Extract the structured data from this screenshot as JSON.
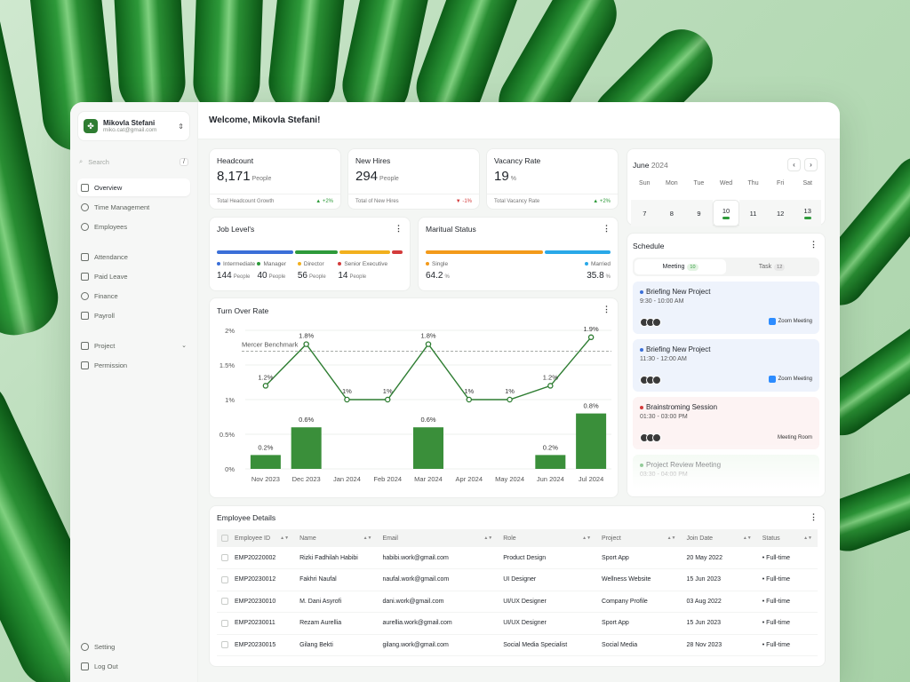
{
  "user": {
    "name": "Mikovla Stefani",
    "email": "miko.cat@gmail.com"
  },
  "search": {
    "placeholder": "Search",
    "shortcut": "/"
  },
  "nav": {
    "primary": [
      "Overview",
      "Time Management",
      "Employees"
    ],
    "secondary": [
      "Attendance",
      "Paid Leave",
      "Finance",
      "Payroll"
    ],
    "tertiary": [
      "Project",
      "Permission"
    ],
    "bottom": [
      "Setting",
      "Log Out"
    ]
  },
  "welcome": "Welcome, Mikovla Stefani!",
  "stats": [
    {
      "label": "Headcount",
      "value": "8,171",
      "unit": "People",
      "foot": "Total Headcount Growth",
      "change": "+2%",
      "dir": "up",
      "arrow": "▲"
    },
    {
      "label": "New Hires",
      "value": "294",
      "unit": "People",
      "foot": "Total of New Hires",
      "change": "-1%",
      "dir": "down",
      "arrow": "▼"
    },
    {
      "label": "Vacancy Rate",
      "value": "19",
      "unit": "%",
      "foot": "Total Vacancy Rate",
      "change": "+2%",
      "dir": "up",
      "arrow": "▲"
    }
  ],
  "job_levels": {
    "title": "Job Level's",
    "items": [
      {
        "label": "Intermediate",
        "value": "144",
        "unit": "People",
        "color": "#3b6fd8",
        "weight": 144
      },
      {
        "label": "Manager",
        "value": "40",
        "unit": "People",
        "color": "#2e9a3a",
        "weight": 80
      },
      {
        "label": "Director",
        "value": "56",
        "unit": "People",
        "color": "#f2b01e",
        "weight": 95
      },
      {
        "label": "Senior Executive",
        "value": "14",
        "unit": "People",
        "color": "#d33b3b",
        "weight": 20
      }
    ]
  },
  "marital": {
    "title": "Maritual Status",
    "items": [
      {
        "label": "Single",
        "value": "64.2",
        "unit": "%",
        "color": "#f39a1a"
      },
      {
        "label": "Married",
        "value": "35.8",
        "unit": "%",
        "color": "#29a8e8"
      }
    ]
  },
  "chart_data": {
    "type": "bar",
    "title": "Turn Over Rate",
    "categories": [
      "Nov 2023",
      "Dec 2023",
      "Jan 2024",
      "Feb 2024",
      "Mar 2024",
      "Apr 2024",
      "May 2024",
      "Jun 2024",
      "Jul 2024"
    ],
    "y_ticks": [
      "0%",
      "0.5%",
      "1%",
      "1.5%",
      "2%"
    ],
    "ylim": [
      0,
      2
    ],
    "benchmark": {
      "label": "Mercer Benchmark",
      "value": 1.7
    },
    "series": [
      {
        "type": "bar",
        "values": [
          0.2,
          0.6,
          0,
          0,
          0.6,
          0,
          0,
          0.2,
          0.8
        ],
        "labels": [
          "0.2%",
          "0.6%",
          "",
          "",
          "0.6%",
          "",
          "",
          "0.2%",
          "0.8%"
        ],
        "color": "#3a8f3a"
      },
      {
        "type": "line",
        "values": [
          1.2,
          1.8,
          1,
          1,
          1.8,
          1,
          1,
          1.2,
          1.9
        ],
        "labels": [
          "1.2%",
          "1.8%",
          "1%",
          "1%",
          "1.8%",
          "1%",
          "1%",
          "1.2%",
          "1.9%"
        ],
        "color": "#2e7d32"
      }
    ],
    "grid": true
  },
  "calendar": {
    "month": "June",
    "year": "2024",
    "days": [
      "Sun",
      "Mon",
      "Tue",
      "Wed",
      "Thu",
      "Fri",
      "Sat"
    ],
    "dates": [
      "7",
      "8",
      "9",
      "10",
      "11",
      "12",
      "13"
    ]
  },
  "schedule": {
    "title": "Schedule",
    "tabs": [
      {
        "label": "Meeting",
        "count": "10"
      },
      {
        "label": "Task",
        "count": "12"
      }
    ],
    "events": [
      {
        "title": "Briefing New Project",
        "time": "9:30 - 10:00 AM",
        "location": "Zoom Meeting",
        "dot": "#3b6fd8",
        "bg": "#eef3fc"
      },
      {
        "title": "Briefing New Project",
        "time": "11:30 - 12:00 AM",
        "location": "Zoom Meeting",
        "dot": "#3b6fd8",
        "bg": "#eef3fc"
      },
      {
        "title": "Brainstroming Session",
        "time": "01:30 - 03:00 PM",
        "location": "Meeting Room",
        "dot": "#d33b3b",
        "bg": "#fdf3f3"
      },
      {
        "title": "Project Review Meeting",
        "time": "03:30 - 04:00 PM",
        "location": "",
        "dot": "#2e9a3a",
        "bg": "#f1f9f1"
      }
    ]
  },
  "employees": {
    "title": "Employee Details",
    "columns": [
      "Employee ID",
      "Name",
      "Email",
      "Role",
      "Project",
      "Join Date",
      "Status"
    ],
    "rows": [
      [
        "EMP20220002",
        "Rizki Fadhilah Habibi",
        "habibi.work@gmail.com",
        "Product Design",
        "Sport App",
        "20 May 2022",
        "Full-time"
      ],
      [
        "EMP20230012",
        "Fakhri Naufal",
        "naufal.work@gmail.com",
        "UI Designer",
        "Wellness Website",
        "15 Jun 2023",
        "Full-time"
      ],
      [
        "EMP20230010",
        "M. Dani Asyrofi",
        "dani.work@gmail.com",
        "UI/UX Designer",
        "Company Profile",
        "03 Aug 2022",
        "Full-time"
      ],
      [
        "EMP20230011",
        "Rezam Aurellia",
        "aurellia.work@gmail.com",
        "UI/UX Designer",
        "Sport App",
        "15 Jun 2023",
        "Full-time"
      ],
      [
        "EMP20230015",
        "Gilang Bekti",
        "gilang.work@gmail.com",
        "Social Media Specialist",
        "Social Media",
        "28 Nov 2023",
        "Full-time"
      ]
    ]
  }
}
